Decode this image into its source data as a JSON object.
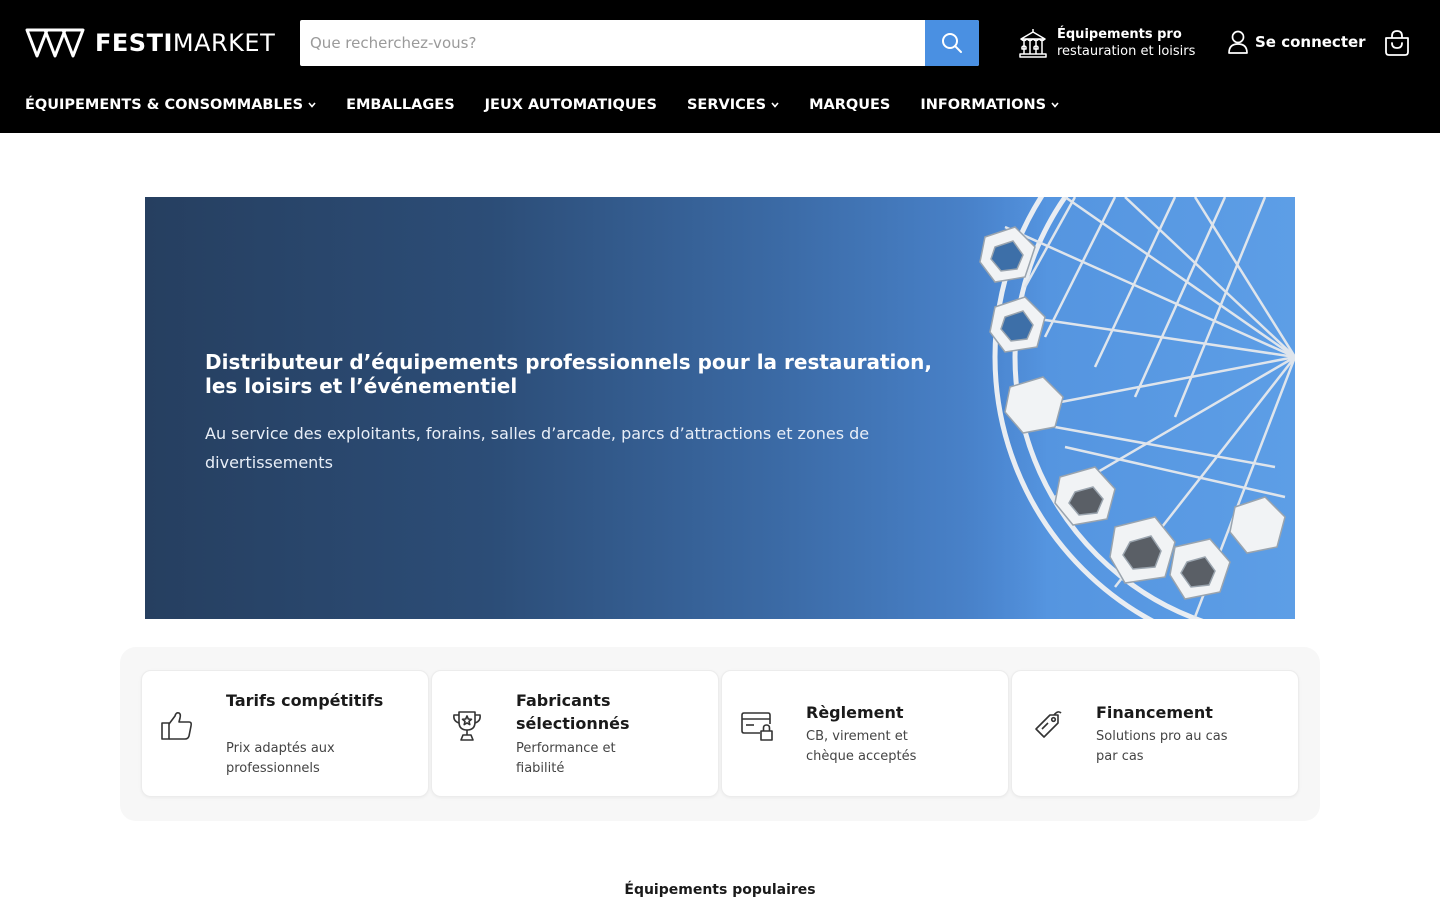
{
  "header": {
    "logo": {
      "brand_bold": "FESTI",
      "brand_light": "MARKET"
    },
    "search": {
      "placeholder": "Que recherchez-vous?"
    },
    "pro": {
      "title": "Équipements pro",
      "subtitle": "restauration et loisirs"
    },
    "login_label": "Se connecter",
    "colors": {
      "background": "#000000",
      "search_button": "#4a90e2"
    }
  },
  "nav": {
    "items": [
      {
        "label": "ÉQUIPEMENTS & CONSOMMABLES",
        "has_dropdown": true
      },
      {
        "label": "EMBALLAGES",
        "has_dropdown": false
      },
      {
        "label": "JEUX AUTOMATIQUES",
        "has_dropdown": false
      },
      {
        "label": "SERVICES",
        "has_dropdown": true
      },
      {
        "label": "MARQUES",
        "has_dropdown": false
      },
      {
        "label": "INFORMATIONS",
        "has_dropdown": true
      }
    ]
  },
  "hero": {
    "title": "Distributeur d’équipements professionnels pour la restauration, les loisirs et l’événementiel",
    "subtitle": "Au service des exploitants, forains, salles d’arcade, parcs d’attractions et zones de divertissements",
    "image_icon": "ferris-wheel"
  },
  "features": [
    {
      "icon": "thumbs-up-icon",
      "title": "Tarifs compétitifs",
      "desc": "Prix adaptés aux professionnels"
    },
    {
      "icon": "trophy-icon",
      "title": "Fabricants sélectionnés",
      "desc": "Performance et fiabilité"
    },
    {
      "icon": "secure-card-icon",
      "title": "Règlement",
      "desc": "CB, virement et chèque acceptés"
    },
    {
      "icon": "price-tag-icon",
      "title": "Financement",
      "desc": "Solutions pro au cas par cas"
    }
  ],
  "section_title": "Équipements populaires"
}
